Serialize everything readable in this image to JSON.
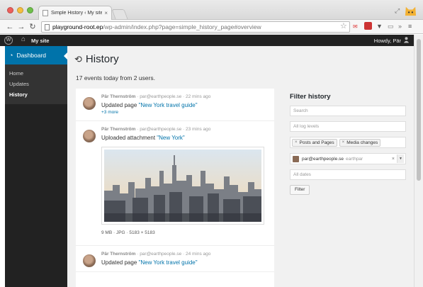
{
  "browser": {
    "tab_title": "Simple History ‹ My site",
    "tab_close": "×",
    "url_host": "playground-root.ep",
    "url_path": "/wp-admin/index.php?page=simple_history_page#overview"
  },
  "adminbar": {
    "site_name": "My site",
    "howdy": "Howdy, Pär"
  },
  "sidebar": {
    "dashboard_label": "Dashboard",
    "items": [
      {
        "label": "Home"
      },
      {
        "label": "Updates"
      },
      {
        "label": "History"
      }
    ]
  },
  "page": {
    "title": "History",
    "summary": "17 events today from 2 users."
  },
  "events": [
    {
      "user": "Pär Thernström",
      "meta": "· par@earthpeople.se · 22 mins ago",
      "action": "Updated page ",
      "link": "\"New York travel guide\"",
      "more": "+3 more"
    },
    {
      "user": "Pär Thernström",
      "meta": "· par@earthpeople.se · 23 mins ago",
      "action": "Uploaded attachment ",
      "link": "\"New York\"",
      "fileinfo": "9 MB · JPG · 5183 × 5183"
    },
    {
      "user": "Pär Thernström",
      "meta": "· par@earthpeople.se · 24 mins ago",
      "action": "Updated page ",
      "link": "\"New York travel guide\""
    }
  ],
  "filter": {
    "title": "Filter history",
    "search_placeholder": "Search",
    "log_levels_placeholder": "All log levels",
    "tags": [
      "Posts and Pages",
      "Media changes"
    ],
    "user_email": "par@earthpeople.se",
    "user_name": "earthpar",
    "dates_placeholder": "All dates",
    "button": "Filter"
  },
  "colors": {
    "wp_blue": "#0073aa",
    "admin_dark": "#222222",
    "link": "#0073aa"
  }
}
